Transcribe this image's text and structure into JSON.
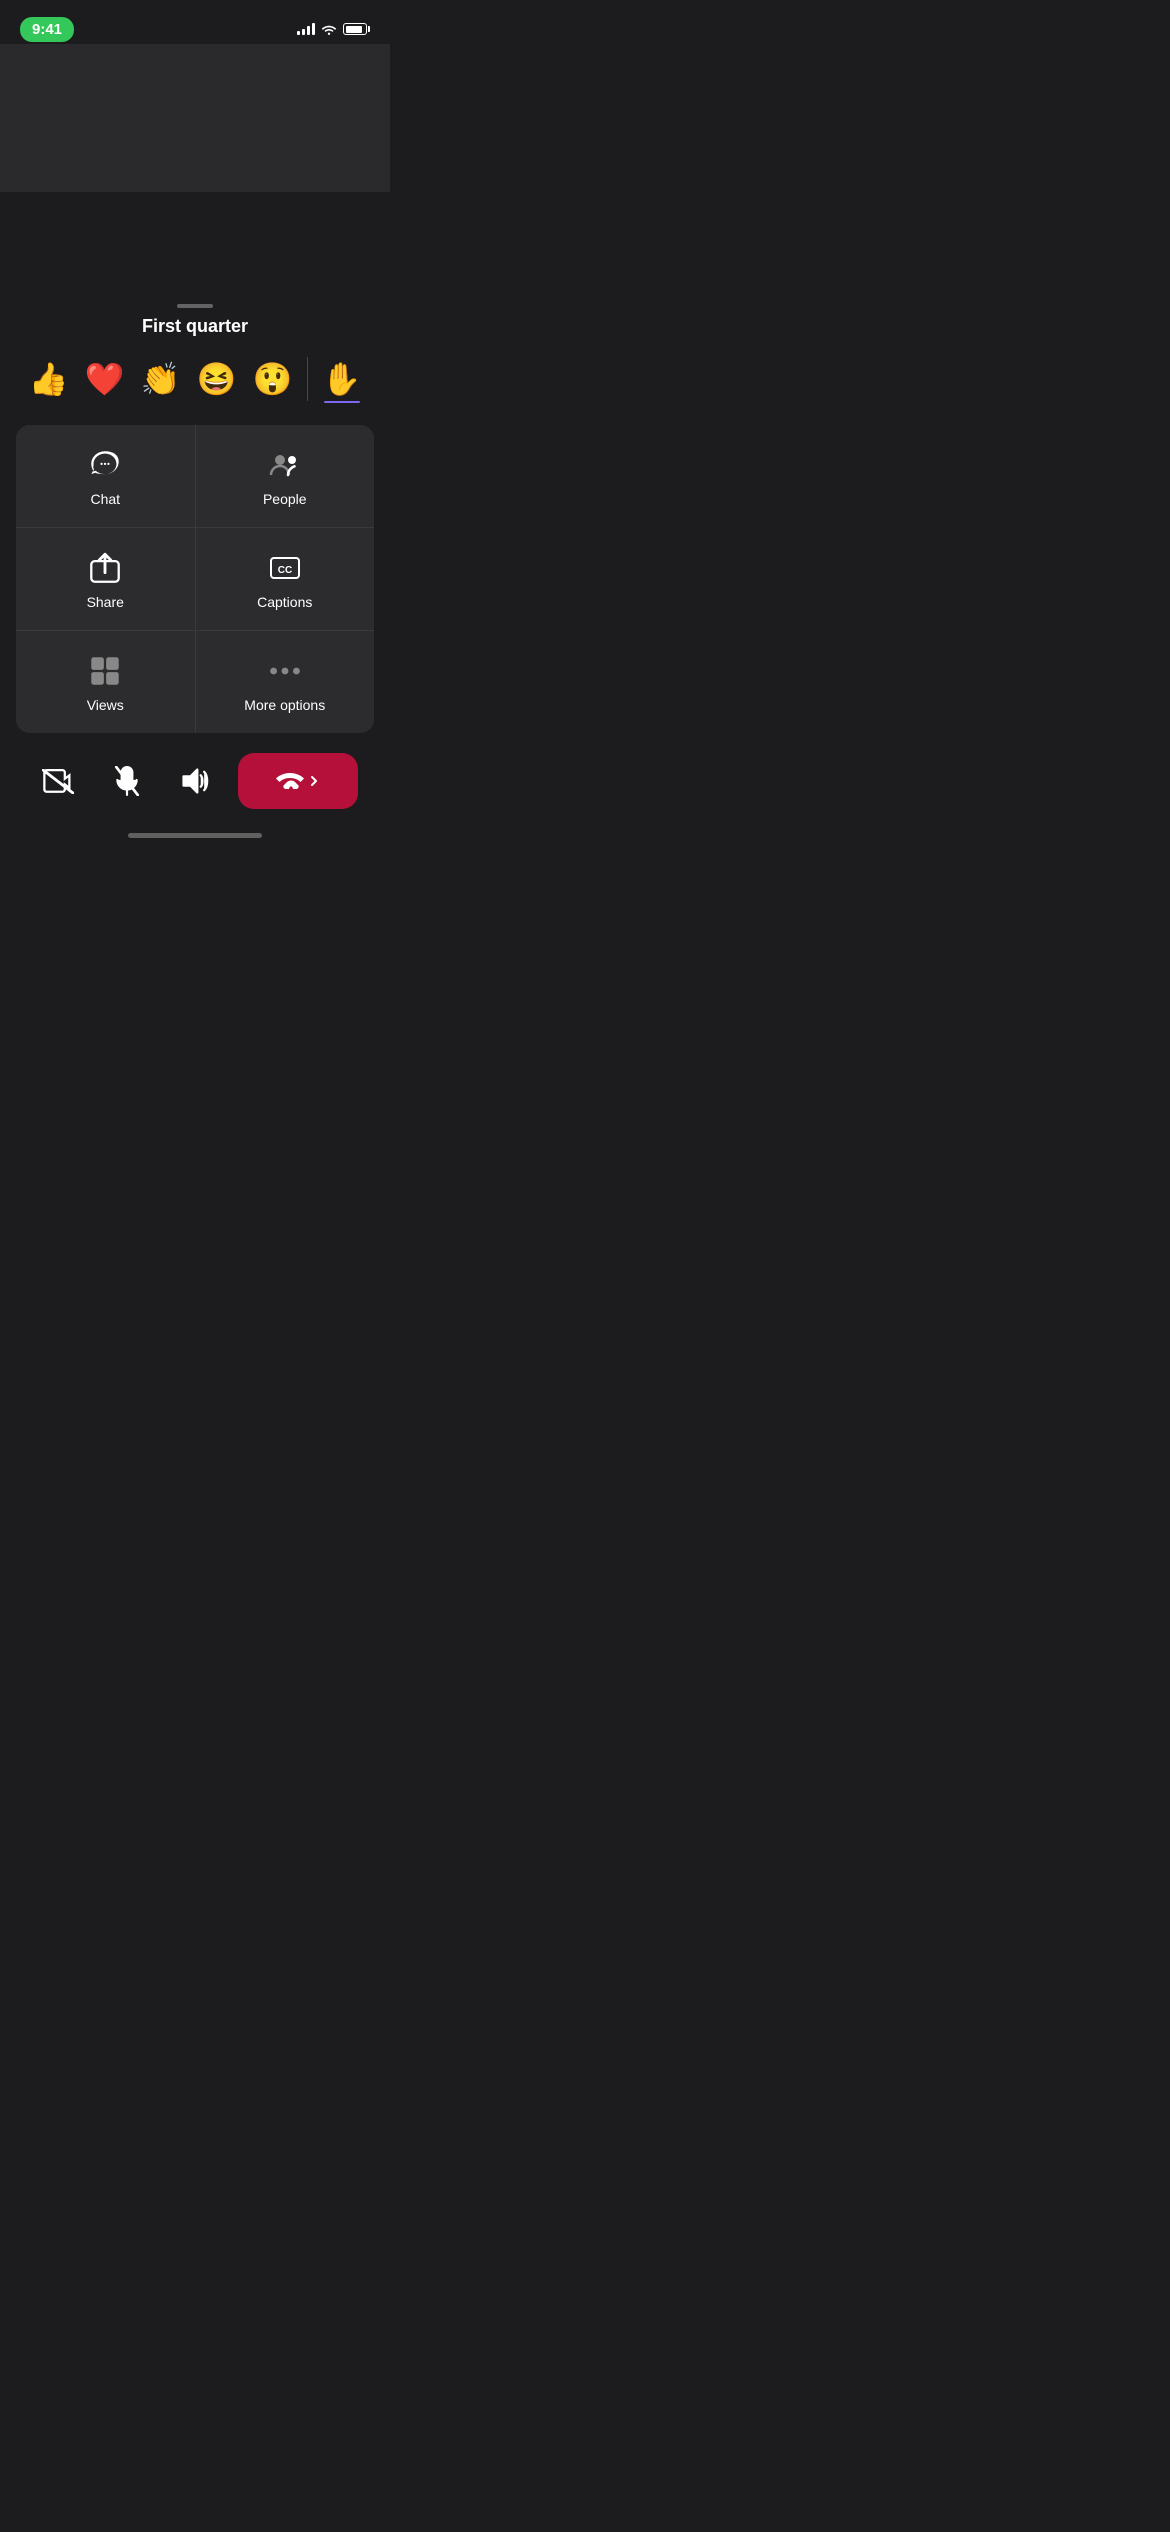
{
  "status_bar": {
    "time": "9:41",
    "battery_level": 85
  },
  "video_area": {
    "background": "#2a2a2c"
  },
  "sheet": {
    "drag_handle_label": "drag handle",
    "title": "First quarter"
  },
  "emojis": [
    {
      "id": "thumbs-up",
      "symbol": "👍",
      "label": "Thumbs up"
    },
    {
      "id": "heart",
      "symbol": "❤️",
      "label": "Heart"
    },
    {
      "id": "clapping",
      "symbol": "👏",
      "label": "Clapping"
    },
    {
      "id": "laughing",
      "symbol": "😆",
      "label": "Laughing"
    },
    {
      "id": "wow",
      "symbol": "😲",
      "label": "Wow"
    },
    {
      "id": "raise-hand",
      "symbol": "✋",
      "label": "Raise hand",
      "active": true
    }
  ],
  "actions": [
    {
      "id": "chat",
      "label": "Chat"
    },
    {
      "id": "people",
      "label": "People"
    },
    {
      "id": "share",
      "label": "Share"
    },
    {
      "id": "captions",
      "label": "Captions"
    },
    {
      "id": "views",
      "label": "Views"
    },
    {
      "id": "more-options",
      "label": "More options"
    }
  ],
  "controls": {
    "video_label": "Video off",
    "mute_label": "Mute",
    "speaker_label": "Speaker",
    "end_call_label": "End call",
    "chevron_label": "More"
  }
}
